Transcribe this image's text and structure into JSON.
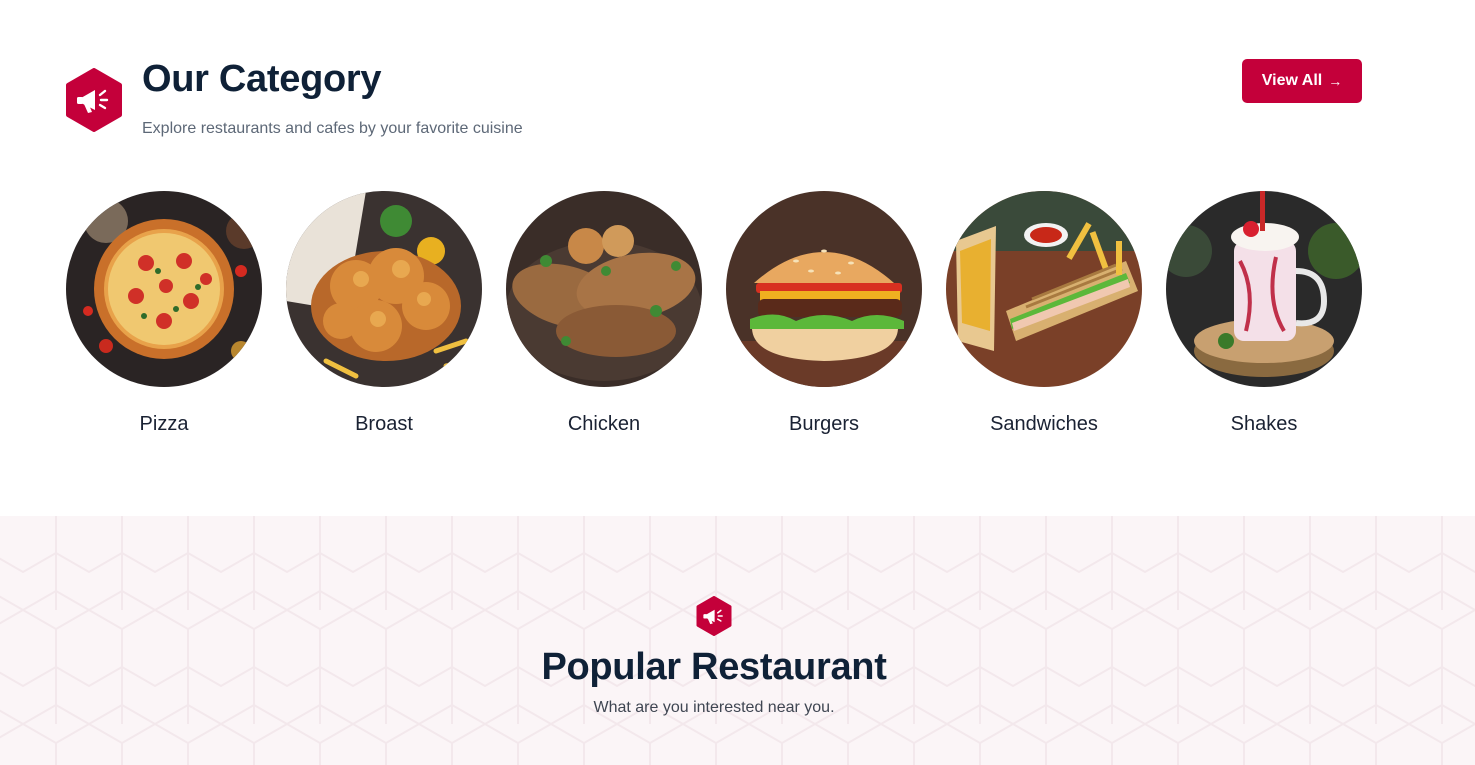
{
  "category": {
    "title": "Our Category",
    "subtitle": "Explore restaurants and cafes by your favorite cuisine",
    "view_all_label": "View All",
    "badge_icon": "megaphone-icon",
    "items": [
      {
        "label": "Pizza"
      },
      {
        "label": "Broast"
      },
      {
        "label": "Chicken"
      },
      {
        "label": "Burgers"
      },
      {
        "label": "Sandwiches"
      },
      {
        "label": "Shakes"
      }
    ]
  },
  "popular": {
    "title": "Popular Restaurant",
    "subtitle": "What are you interested near you.",
    "badge_icon": "megaphone-icon"
  },
  "colors": {
    "accent": "#c4003a",
    "heading": "#0f2137",
    "section_bg": "#fbf5f7"
  }
}
